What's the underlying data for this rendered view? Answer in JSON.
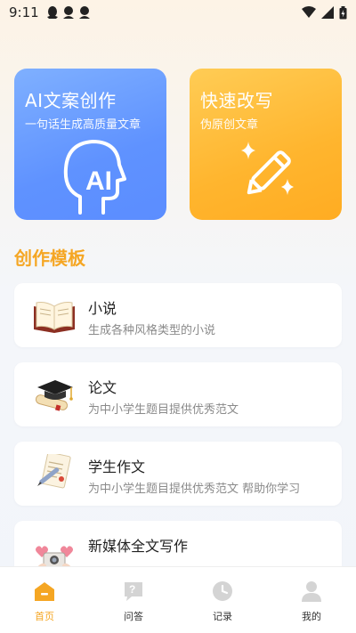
{
  "status_bar": {
    "time": "9:11"
  },
  "features": [
    {
      "title": "AI文案创作",
      "subtitle": "一句话生成高质量文章",
      "icon": "ai-head-icon",
      "color": "#5f92ff"
    },
    {
      "title": "快速改写",
      "subtitle": "伪原创文章",
      "icon": "magic-pen-icon",
      "color": "#ffb52e"
    }
  ],
  "section_title": "创作模板",
  "accent_color": "#f5a623",
  "templates": [
    {
      "name": "小说",
      "desc": "生成各种风格类型的小说",
      "icon": "open-book-icon"
    },
    {
      "name": "论文",
      "desc": "为中小学生题目提供优秀范文",
      "icon": "graduation-cap-icon"
    },
    {
      "name": "学生作文",
      "desc": "为中小学生题目提供优秀范文 帮助你学习",
      "icon": "document-pen-icon"
    },
    {
      "name": "新媒体全文写作",
      "desc": "",
      "icon": "camera-hearts-icon"
    }
  ],
  "tabs": [
    {
      "label": "首页",
      "icon": "home-icon",
      "active": true
    },
    {
      "label": "问答",
      "icon": "chat-icon",
      "active": false
    },
    {
      "label": "记录",
      "icon": "clock-icon",
      "active": false
    },
    {
      "label": "我的",
      "icon": "user-icon",
      "active": false
    }
  ]
}
